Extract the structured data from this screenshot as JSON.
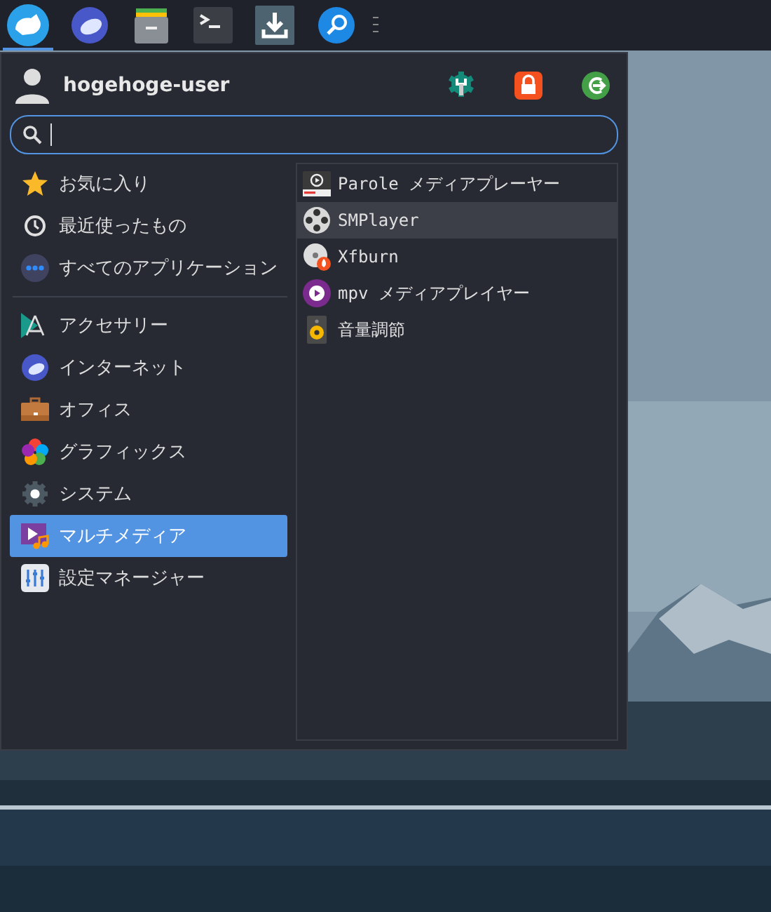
{
  "taskbar": {
    "launchers": [
      {
        "selected": true
      },
      {
        "selected": false
      },
      {
        "selected": false
      },
      {
        "selected": false
      },
      {
        "selected": false
      },
      {
        "selected": false
      }
    ]
  },
  "menu": {
    "user": {
      "name": "hogehoge-user"
    },
    "search": {
      "focused": true
    },
    "shortcuts": [
      {
        "label": "お気に入り",
        "selected": false
      },
      {
        "label": "最近使ったもの",
        "selected": false
      },
      {
        "label": "すべてのアプリケーション",
        "selected": false
      }
    ],
    "categories": [
      {
        "label": "アクセサリー",
        "selected": false
      },
      {
        "label": "インターネット",
        "selected": false
      },
      {
        "label": "オフィス",
        "selected": false
      },
      {
        "label": "グラフィックス",
        "selected": false
      },
      {
        "label": "システム",
        "selected": false
      },
      {
        "label": "マルチメディア",
        "selected": true
      },
      {
        "label": "設定マネージャー",
        "selected": false
      }
    ],
    "apps": [
      {
        "label": "Parole メディアプレーヤー",
        "selected": false
      },
      {
        "label": "SMPlayer",
        "selected": true
      },
      {
        "label": "Xfburn",
        "selected": false
      },
      {
        "label": "mpv メディアプレイヤー",
        "selected": false
      },
      {
        "label": "音量調節",
        "selected": false
      }
    ]
  }
}
